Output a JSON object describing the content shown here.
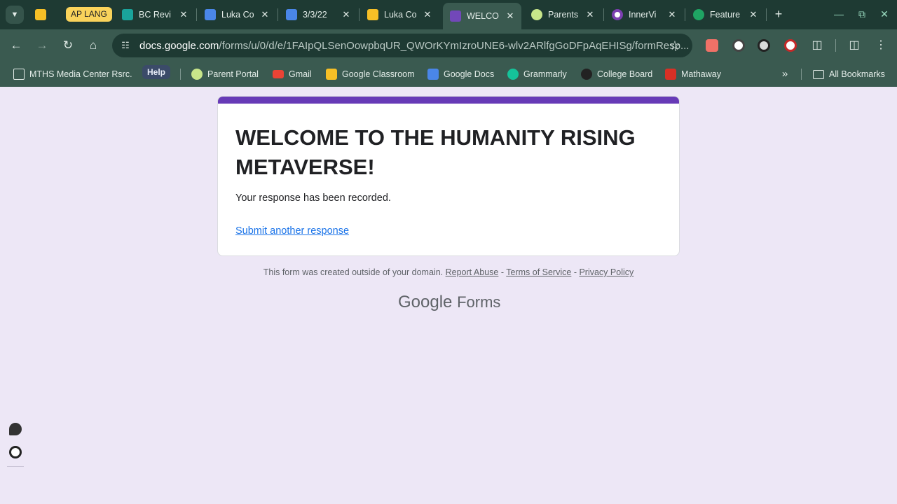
{
  "browser": {
    "tabs": [
      {
        "title": "",
        "icon": "slides-icon"
      },
      {
        "title": "BC Revi",
        "icon": "classroom-icon"
      },
      {
        "title": "Luka Co",
        "icon": "docs-icon"
      },
      {
        "title": "3/3/22",
        "icon": "classroom-icon"
      },
      {
        "title": "Luka Co",
        "icon": "slides-icon"
      },
      {
        "title": "WELCO",
        "icon": "forms-icon",
        "active": true
      },
      {
        "title": "Parents",
        "icon": "parent-portal-icon"
      },
      {
        "title": "InnerVi",
        "icon": "innervi-icon"
      },
      {
        "title": "Feature",
        "icon": "feature-icon"
      }
    ],
    "tab_group_label": "AP LANG",
    "url_host": "docs.google.com",
    "url_path": "/forms/u/0/d/e/1FAIpQLSenOowpbqUR_QWOrKYmIzroUNE6-wlv2ARlfgGoDFpAqEHISg/formResp...",
    "bookmarks": [
      {
        "label": "MTHS Media Center Rsrc.",
        "icon": "folder-settings-icon"
      },
      {
        "label": "Help",
        "icon": ""
      },
      {
        "label": "Parent Portal",
        "icon": "parent-portal-icon"
      },
      {
        "label": "Gmail",
        "icon": "gmail-icon"
      },
      {
        "label": "Google Classroom",
        "icon": "classroom-icon"
      },
      {
        "label": "Google Docs",
        "icon": "docs-icon"
      },
      {
        "label": "Grammarly",
        "icon": "grammarly-icon"
      },
      {
        "label": "College Board",
        "icon": "college-board-icon"
      },
      {
        "label": "Mathaway",
        "icon": "mathaway-icon"
      }
    ],
    "all_bookmarks_label": "All Bookmarks",
    "colors": {
      "frame": "#1e3a33",
      "toolbar": "#3a5a50",
      "text": "#e3ece8"
    }
  },
  "form": {
    "title": "WELCOME TO THE HUMANITY RISING METAVERSE!",
    "message": "Your response has been recorded.",
    "link": "Submit another response",
    "accent_color": "#673ab7",
    "background_color": "#ede7f6"
  },
  "footer": {
    "text": "This form was created outside of your domain.",
    "report_abuse": "Report Abuse",
    "separator": " - ",
    "terms": "Terms of Service",
    "privacy": "Privacy Policy",
    "brand_google": "Google",
    "brand_forms": "Forms"
  }
}
